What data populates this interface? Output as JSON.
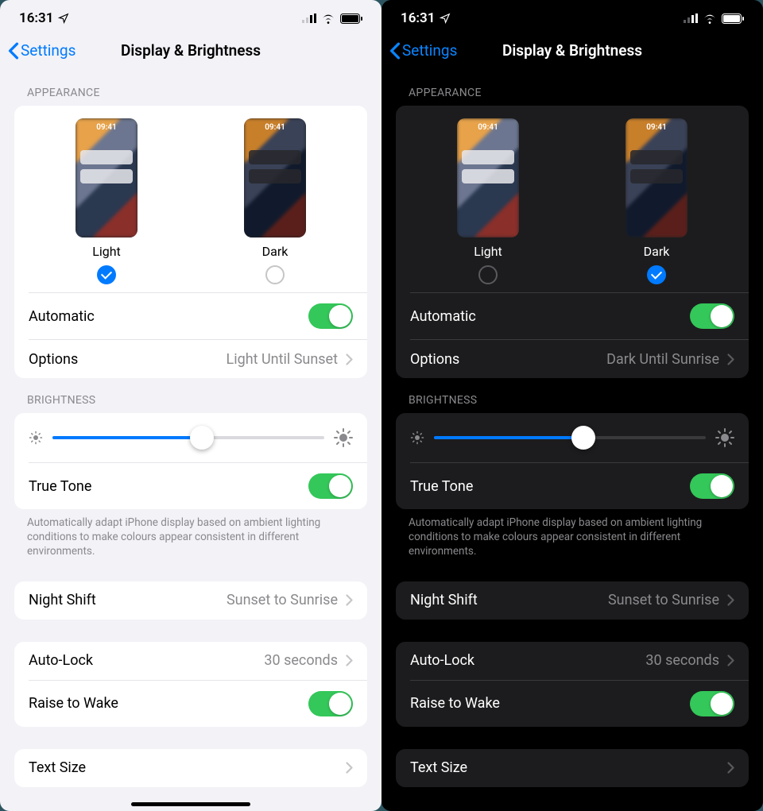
{
  "status": {
    "time": "16:31"
  },
  "nav": {
    "back": "Settings",
    "title": "Display & Brightness"
  },
  "appearance": {
    "header": "APPEARANCE",
    "preview_time": "09:41",
    "light_label": "Light",
    "dark_label": "Dark",
    "automatic_label": "Automatic",
    "options_label": "Options",
    "options_value_light": "Light Until Sunset",
    "options_value_dark": "Dark Until Sunrise"
  },
  "brightness": {
    "header": "BRIGHTNESS",
    "slider_percent": 55,
    "truetone_label": "True Tone",
    "truetone_note": "Automatically adapt iPhone display based on ambient lighting conditions to make colours appear consistent in different environments."
  },
  "nightshift": {
    "label": "Night Shift",
    "value": "Sunset to Sunrise"
  },
  "autolock": {
    "label": "Auto-Lock",
    "value": "30 seconds"
  },
  "raise_to_wake": {
    "label": "Raise to Wake"
  },
  "text_size": {
    "label": "Text Size"
  }
}
